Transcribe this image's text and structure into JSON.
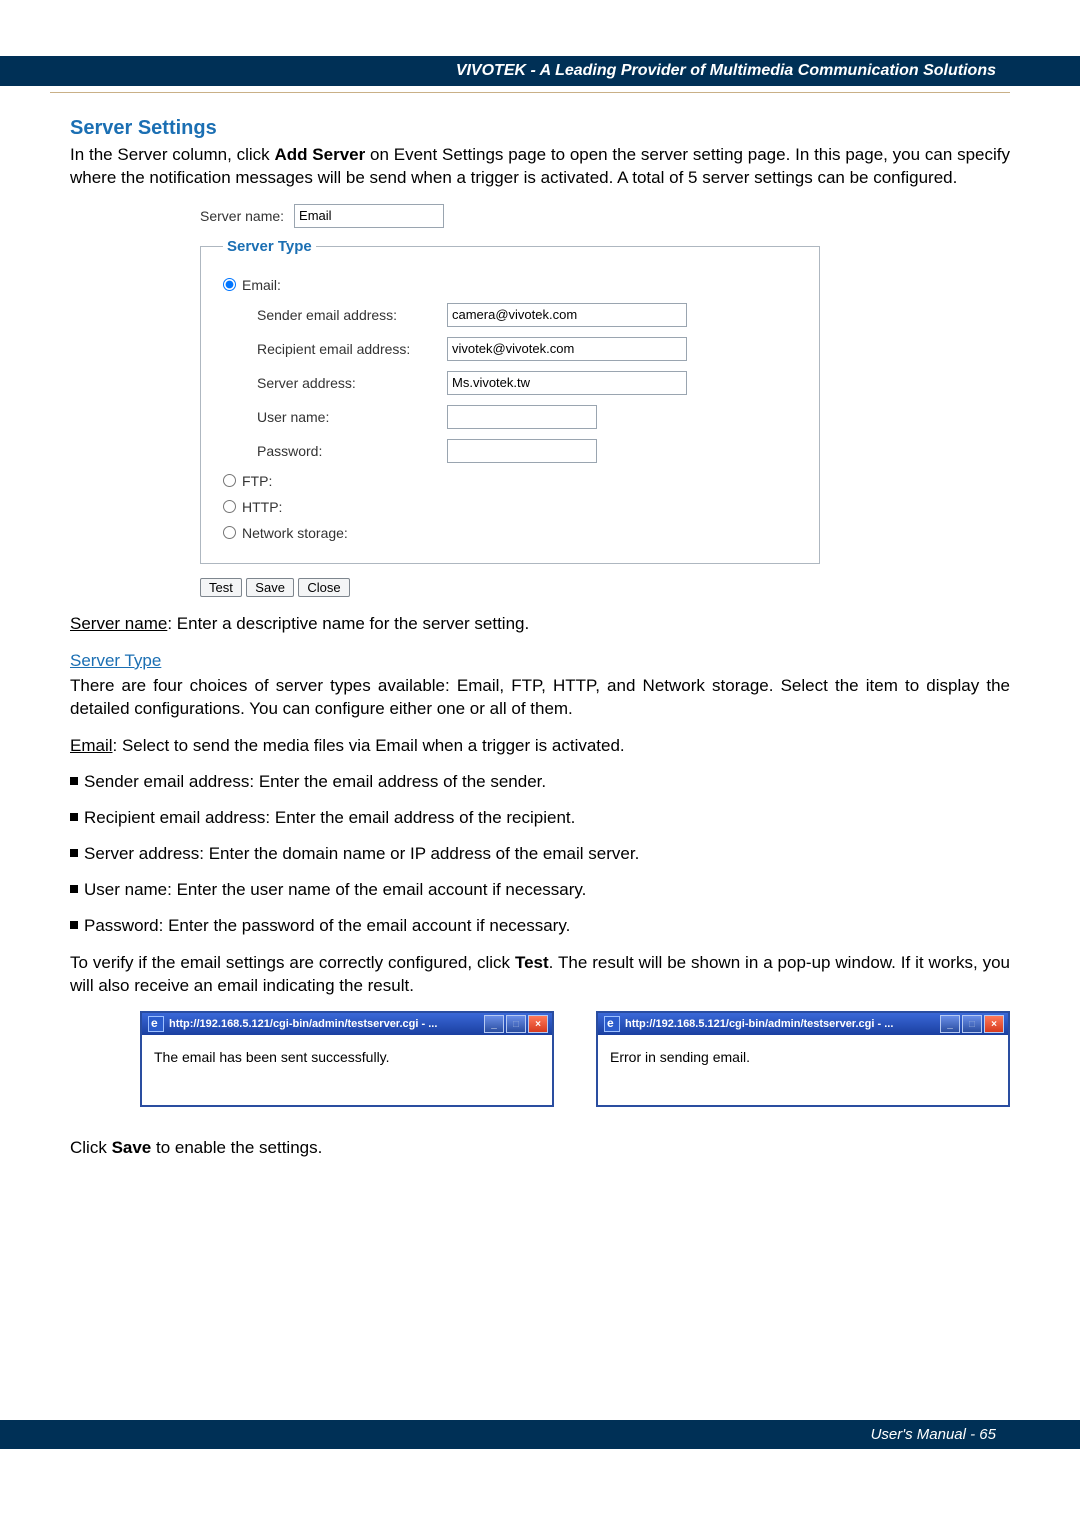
{
  "header": {
    "brand": "VIVOTEK - A Leading Provider of Multimedia Communication Solutions"
  },
  "section": {
    "title": "Server Settings",
    "intro": "In the Server column, click Add Server on Event Settings page to open the server setting page. In this page, you can specify where the notification messages will be send when a trigger is activated. A total of 5 server settings can be configured."
  },
  "settings": {
    "serverNameLabel": "Server name:",
    "serverNameValue": "Email",
    "legend": "Server Type",
    "radios": {
      "email": "Email:",
      "ftp": "FTP:",
      "http": "HTTP:",
      "network": "Network storage:"
    },
    "email": {
      "senderLabel": "Sender email address:",
      "senderValue": "camera@vivotek.com",
      "recipientLabel": "Recipient email address:",
      "recipientValue": "vivotek@vivotek.com",
      "serverAddrLabel": "Server address:",
      "serverAddrValue": "Ms.vivotek.tw",
      "userLabel": "User name:",
      "userValue": "",
      "passLabel": "Password:",
      "passValue": ""
    },
    "buttons": {
      "test": "Test",
      "save": "Save",
      "close": "Close"
    }
  },
  "explain": {
    "serverName": "Server name: Enter a descriptive name for the server setting.",
    "serverTypeHeading": "Server Type",
    "serverTypeText": "There are four choices of server types available: Email, FTP, HTTP, and Network storage. Select the item to display the detailed configurations. You can configure either one or all of them.",
    "emailLine": "Email: Select to send the media files via Email when a trigger is activated.",
    "items": [
      "Sender email address: Enter the email address of the sender.",
      "Recipient email address: Enter the email address of the recipient.",
      "Server address: Enter the domain name or IP address of the email server.",
      "User name: Enter the user name of the email account if necessary.",
      "Password: Enter the password of the email account if necessary."
    ],
    "testText": "To verify if the email settings are correctly configured, click Test. The result will be shown in a pop-up window. If it works, you will also receive an email indicating the result."
  },
  "popups": {
    "title": "http://192.168.5.121/cgi-bin/admin/testserver.cgi - ...",
    "successBody": "The email has been sent successfully.",
    "errorBody": "Error in sending email."
  },
  "afterPopups": "Click Save to enable the settings.",
  "footer": "User's Manual - 65"
}
